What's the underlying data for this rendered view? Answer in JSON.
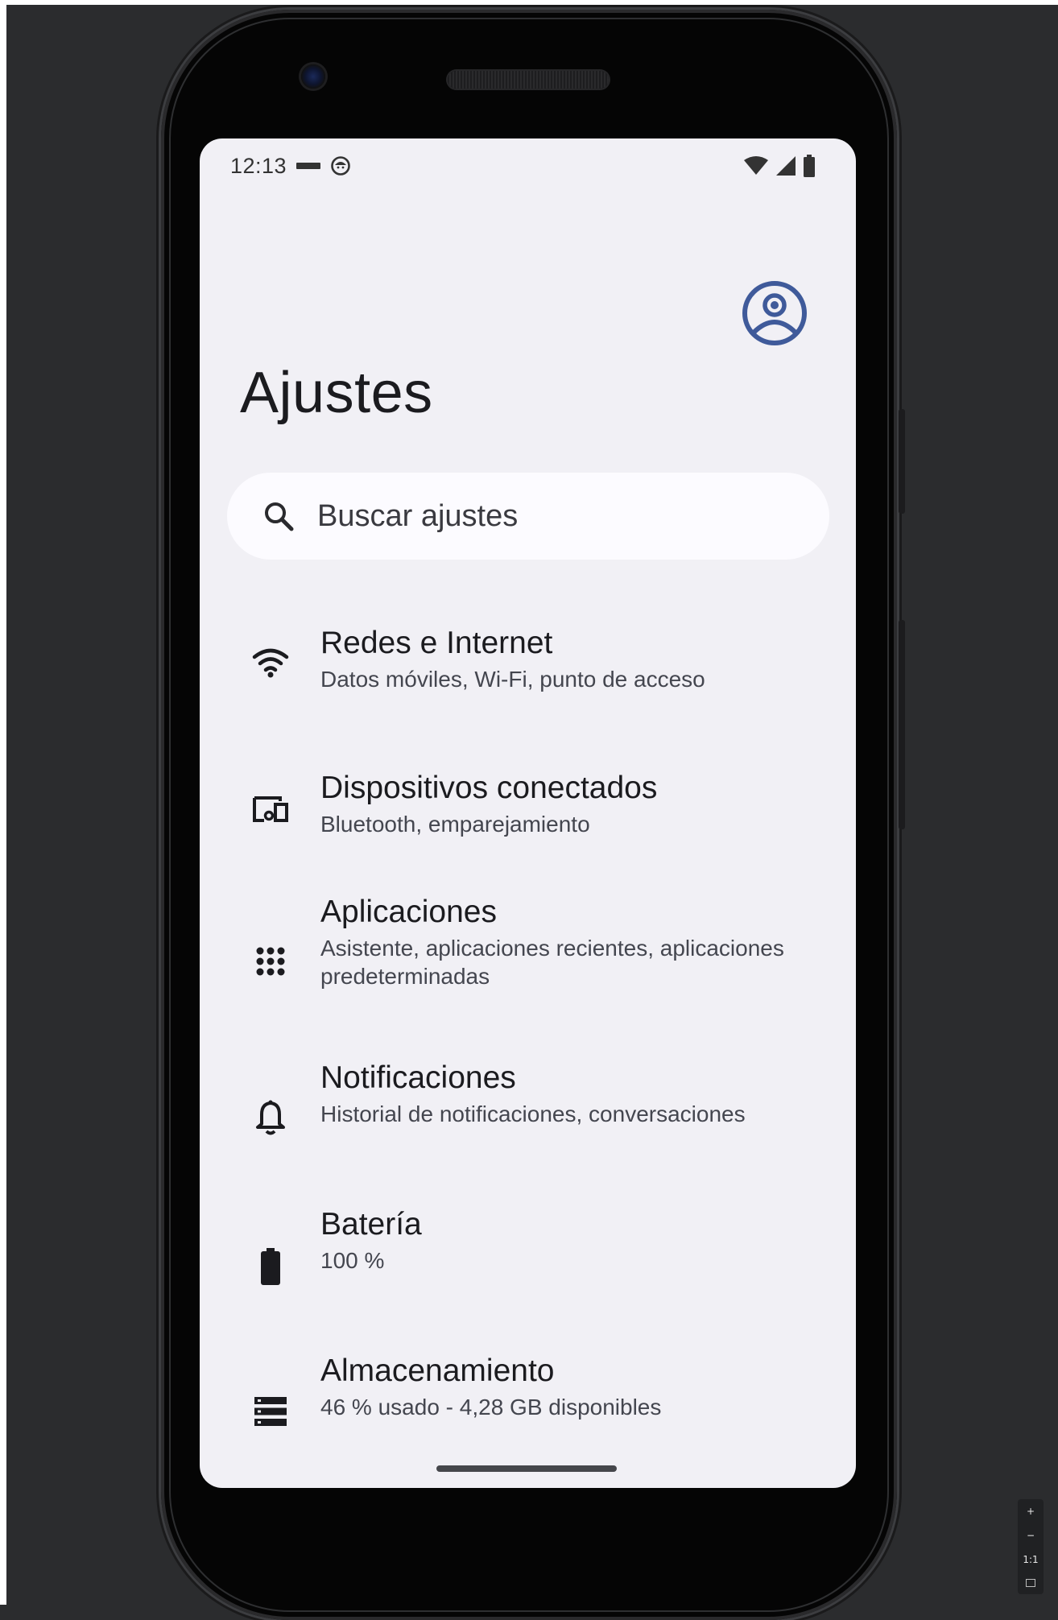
{
  "statusbar": {
    "time": "12:13",
    "icons": [
      "dash-icon",
      "android-face-icon",
      "wifi-icon",
      "signal-icon",
      "battery-icon"
    ]
  },
  "header": {
    "title": "Ajustes",
    "account_icon": "account-circle-icon"
  },
  "search": {
    "placeholder": "Buscar ajustes",
    "icon": "search-icon"
  },
  "settings": {
    "items": [
      {
        "icon": "wifi-icon",
        "title": "Redes e Internet",
        "subtitle": "Datos móviles, Wi-Fi, punto de acceso"
      },
      {
        "icon": "devices-icon",
        "title": "Dispositivos conectados",
        "subtitle": "Bluetooth, emparejamiento"
      },
      {
        "icon": "apps-grid-icon",
        "title": "Aplicaciones",
        "subtitle": "Asistente, aplicaciones recientes, aplicaciones predeterminadas"
      },
      {
        "icon": "bell-icon",
        "title": "Notificaciones",
        "subtitle": "Historial de notificaciones, conversaciones"
      },
      {
        "icon": "battery-icon",
        "title": "Batería",
        "subtitle": "100 %"
      },
      {
        "icon": "storage-icon",
        "title": "Almacenamiento",
        "subtitle": "46 % usado - 4,28 GB disponibles"
      }
    ]
  },
  "zoom_controls": {
    "zoom_in": "+",
    "zoom_out": "−",
    "actual_size": "1:1"
  },
  "colors": {
    "screen_background": "#f1f0f5",
    "search_background": "#fcfbff",
    "account_accent": "#3f5a9a",
    "text_primary": "#1b1b1f",
    "text_secondary": "#44464f",
    "desktop_background": "#2b2c2e"
  }
}
